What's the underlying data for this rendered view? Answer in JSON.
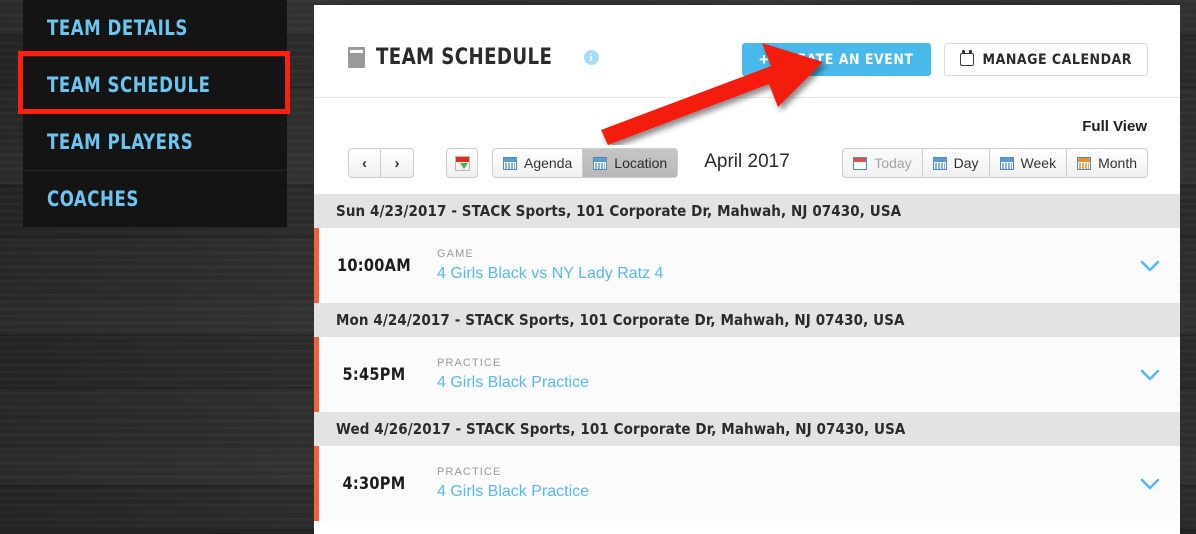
{
  "colors": {
    "accent_blue": "#49b9ec",
    "link_blue": "#5bb8ea",
    "sidebar_link": "#6cc5ef",
    "annotation_red": "#ff1f10",
    "event_bar": "#f2603c",
    "panel_bg": "#ffffff",
    "day_header_bg": "#e3e3e3",
    "page_bg": "#262626"
  },
  "sidebar": {
    "items": [
      {
        "label": "TEAM DETAILS",
        "name": "sidebar-item-team-details",
        "highlighted": false
      },
      {
        "label": "TEAM SCHEDULE",
        "name": "sidebar-item-team-schedule",
        "highlighted": true
      },
      {
        "label": "TEAM PLAYERS",
        "name": "sidebar-item-team-players",
        "highlighted": false
      },
      {
        "label": "COACHES",
        "name": "sidebar-item-coaches",
        "highlighted": false
      }
    ]
  },
  "header": {
    "title": "TEAM SCHEDULE",
    "calendar_icon": "calendar-icon",
    "info_icon": "info-icon",
    "info_icon_glyph": "i",
    "create_event": {
      "label": "CREATE AN EVENT",
      "plus_glyph": "+"
    },
    "manage_calendar": {
      "label": "MANAGE CALENDAR",
      "icon": "calendar-icon"
    }
  },
  "toolbar": {
    "full_view_label": "Full View",
    "prev_label": "‹",
    "next_label": "›",
    "ical_export_icon": "calendar-download-icon",
    "view_modes": [
      {
        "label": "Agenda",
        "active": false,
        "icon": "calendar-grid-icon"
      },
      {
        "label": "Location",
        "active": true,
        "icon": "calendar-grid-icon"
      }
    ],
    "month_label": "April 2017",
    "range_buttons": [
      {
        "label": "Today",
        "disabled": true,
        "icon": "calendar-today-icon"
      },
      {
        "label": "Day",
        "disabled": false,
        "icon": "calendar-day-icon"
      },
      {
        "label": "Week",
        "disabled": false,
        "icon": "calendar-week-icon"
      },
      {
        "label": "Month",
        "disabled": false,
        "icon": "calendar-month-icon"
      }
    ]
  },
  "schedule": {
    "days": [
      {
        "header": "Sun 4/23/2017 - STACK Sports, 101 Corporate Dr, Mahwah, NJ 07430, USA",
        "events": [
          {
            "time": "10:00AM",
            "type": "GAME",
            "title": "4 Girls Black vs NY Lady Ratz 4",
            "expand_icon": "chevron-down-icon"
          }
        ]
      },
      {
        "header": "Mon 4/24/2017 - STACK Sports, 101 Corporate Dr, Mahwah, NJ 07430, USA",
        "events": [
          {
            "time": "5:45PM",
            "type": "PRACTICE",
            "title": "4 Girls Black Practice",
            "expand_icon": "chevron-down-icon"
          }
        ]
      },
      {
        "header": "Wed 4/26/2017 - STACK Sports, 101 Corporate Dr, Mahwah, NJ 07430, USA",
        "events": [
          {
            "time": "4:30PM",
            "type": "PRACTICE",
            "title": "4 Girls Black Practice",
            "expand_icon": "chevron-down-icon"
          }
        ]
      }
    ]
  },
  "annotations": {
    "arrow": "red-arrow-pointing-to-create-an-event",
    "highlight_box": "red-box-around-team-schedule"
  }
}
